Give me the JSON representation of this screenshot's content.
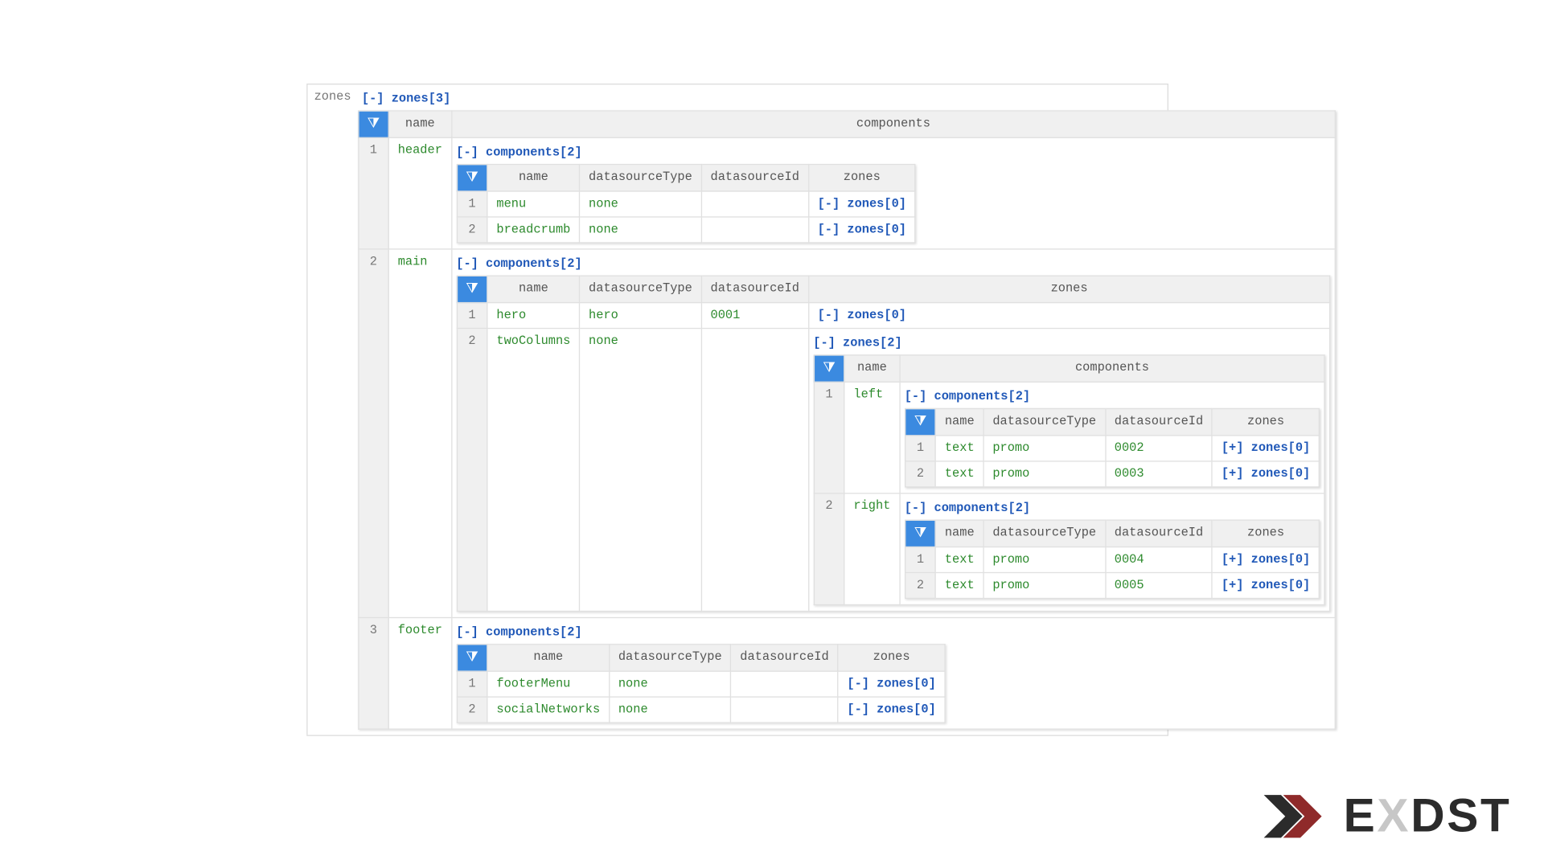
{
  "rootLabel": "zones",
  "rootToggle": "[-] zones[3]",
  "columns": {
    "name": "name",
    "components": "components",
    "datasourceType": "datasourceType",
    "datasourceId": "datasourceId",
    "zones": "zones"
  },
  "componentsToggle": "[-] components[2]",
  "zonesCollapsed0": "[-] zones[0]",
  "zonesCollapsedPlus0": "[+] zones[0]",
  "zones2Toggle": "[-] zones[2]",
  "rows": [
    {
      "idx": "1",
      "name": "header",
      "components": [
        {
          "idx": "1",
          "name": "menu",
          "dsType": "none",
          "dsId": "",
          "zones": "[-] zones[0]"
        },
        {
          "idx": "2",
          "name": "breadcrumb",
          "dsType": "none",
          "dsId": "",
          "zones": "[-] zones[0]"
        }
      ]
    },
    {
      "idx": "2",
      "name": "main",
      "components": [
        {
          "idx": "1",
          "name": "hero",
          "dsType": "hero",
          "dsId": "0001",
          "zones": "[-] zones[0]"
        },
        {
          "idx": "2",
          "name": "twoColumns",
          "dsType": "none",
          "dsId": "",
          "innerZonesToggle": "[-] zones[2]",
          "innerZones": [
            {
              "idx": "1",
              "name": "left",
              "components": [
                {
                  "idx": "1",
                  "name": "text",
                  "dsType": "promo",
                  "dsId": "0002",
                  "zones": "[+] zones[0]"
                },
                {
                  "idx": "2",
                  "name": "text",
                  "dsType": "promo",
                  "dsId": "0003",
                  "zones": "[+] zones[0]"
                }
              ]
            },
            {
              "idx": "2",
              "name": "right",
              "components": [
                {
                  "idx": "1",
                  "name": "text",
                  "dsType": "promo",
                  "dsId": "0004",
                  "zones": "[+] zones[0]"
                },
                {
                  "idx": "2",
                  "name": "text",
                  "dsType": "promo",
                  "dsId": "0005",
                  "zones": "[+] zones[0]"
                }
              ]
            }
          ]
        }
      ]
    },
    {
      "idx": "3",
      "name": "footer",
      "components": [
        {
          "idx": "1",
          "name": "footerMenu",
          "dsType": "none",
          "dsId": "",
          "zones": "[-] zones[0]"
        },
        {
          "idx": "2",
          "name": "socialNetworks",
          "dsType": "none",
          "dsId": "",
          "zones": "[-] zones[0]"
        }
      ]
    }
  ],
  "logo": "EXDST"
}
